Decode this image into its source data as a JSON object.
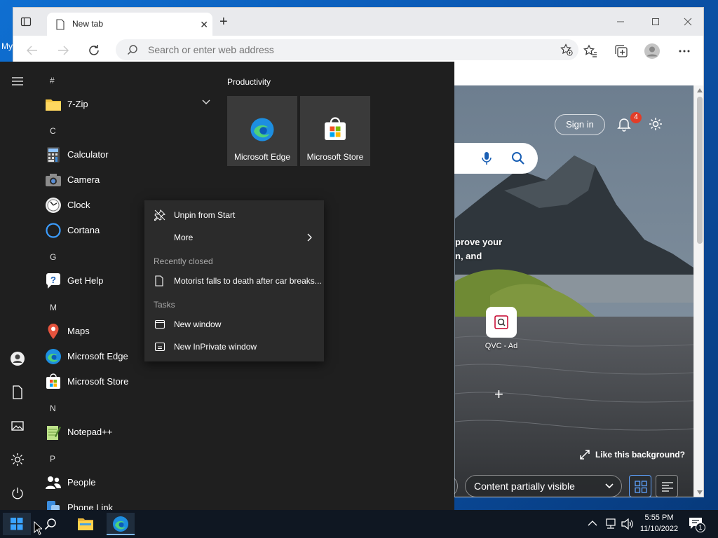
{
  "desktop": {
    "label": "My"
  },
  "browser": {
    "tab": {
      "title": "New tab"
    },
    "address": {
      "placeholder": "Search or enter web address"
    }
  },
  "newtab": {
    "sign_in": "Sign in",
    "notification_count": "4",
    "promo_line1": "prove your",
    "promo_line2": "n, and",
    "tile_label": "QVC - Ad",
    "like_bg": "Like this background?",
    "content_dropdown": "Content partially visible"
  },
  "startmenu": {
    "apps": {
      "hash": "#",
      "sevenzip": "7-Zip",
      "c": "C",
      "calculator": "Calculator",
      "camera": "Camera",
      "clock": "Clock",
      "cortana": "Cortana",
      "g": "G",
      "gethelp": "Get Help",
      "m": "M",
      "maps": "Maps",
      "edge": "Microsoft Edge",
      "store": "Microsoft Store",
      "n": "N",
      "notepad": "Notepad++",
      "p": "P",
      "people": "People",
      "phonelink": "Phone Link"
    },
    "group": {
      "title": "Productivity",
      "tiles": [
        "Microsoft Edge",
        "Microsoft Store"
      ]
    }
  },
  "context_menu": {
    "unpin": "Unpin from Start",
    "more": "More",
    "recently_closed_header": "Recently closed",
    "recent_item": "Motorist falls to death after car breaks...",
    "tasks_header": "Tasks",
    "new_window": "New window",
    "new_inprivate": "New InPrivate window"
  },
  "taskbar": {
    "time": "5:55 PM",
    "date": "11/10/2022",
    "notification_count": "1"
  },
  "colors": {
    "accent": "#0078d4",
    "start_bg": "#1f1f1f",
    "context_bg": "#2b2b2b",
    "taskbar_bg": "#0f1722",
    "badge_red": "#e23d28"
  },
  "icons": [
    "search-icon",
    "refresh-icon",
    "favorites-icon",
    "collections-icon",
    "profile-icon",
    "more-icon",
    "hamburger-icon",
    "user-icon",
    "document-icon",
    "pictures-icon",
    "settings-icon",
    "power-icon",
    "windows-icon",
    "file-explorer-icon",
    "edge-icon",
    "bell-icon",
    "mic-icon"
  ]
}
